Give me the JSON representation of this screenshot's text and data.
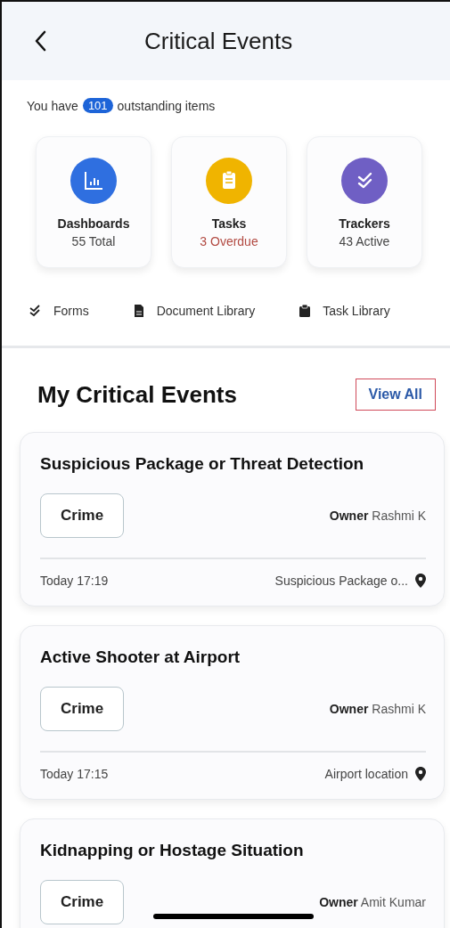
{
  "header": {
    "title": "Critical Events"
  },
  "summary": {
    "before": "You have",
    "count": "101",
    "after": "outstanding items"
  },
  "tiles": [
    {
      "kind": "dashboards",
      "label": "Dashboards",
      "detail": "55 Total",
      "alert": false
    },
    {
      "kind": "tasks",
      "label": "Tasks",
      "detail": "3 Overdue",
      "alert": true
    },
    {
      "kind": "trackers",
      "label": "Trackers",
      "detail": "43 Active",
      "alert": false
    }
  ],
  "links": [
    {
      "kind": "forms",
      "label": "Forms"
    },
    {
      "kind": "document",
      "label": "Document Library"
    },
    {
      "kind": "task",
      "label": "Task Library"
    }
  ],
  "section": {
    "title": "My Critical Events",
    "action": "View All"
  },
  "events": [
    {
      "title": "Suspicious Package or Threat Detection",
      "tag": "Crime",
      "owner_label": "Owner",
      "owner": "Rashmi K",
      "time": "Today 17:19",
      "location": "Suspicious Package o..."
    },
    {
      "title": "Active Shooter at Airport",
      "tag": "Crime",
      "owner_label": "Owner",
      "owner": "Rashmi K",
      "time": "Today 17:15",
      "location": "Airport location"
    },
    {
      "title": "Kidnapping or Hostage Situation",
      "tag": "Crime",
      "owner_label": "Owner",
      "owner": "Amit Kumar"
    }
  ]
}
